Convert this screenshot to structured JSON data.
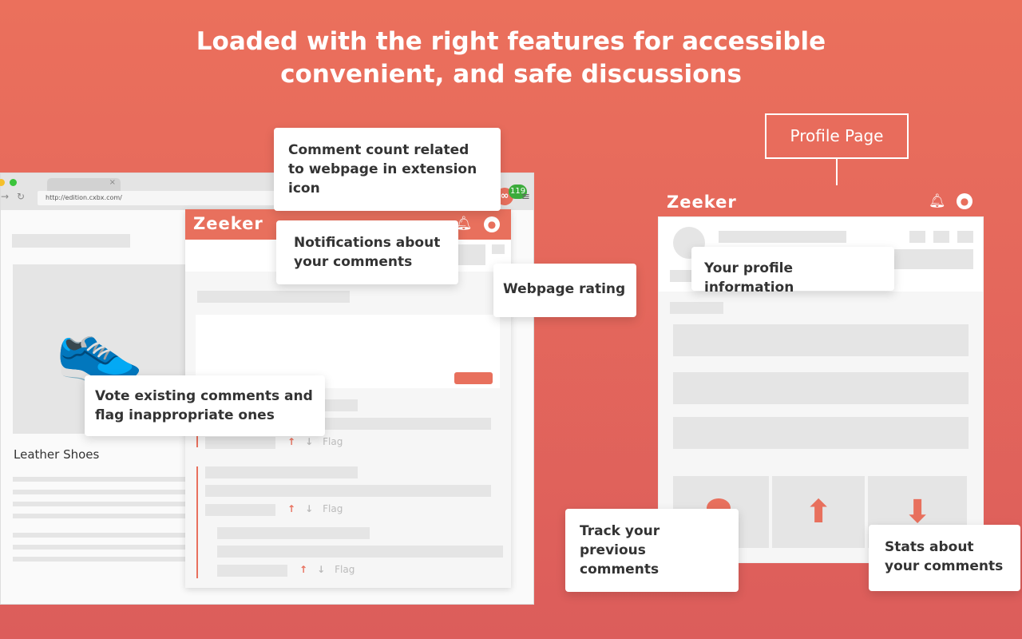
{
  "headline": {
    "line1": "Loaded with the right features for accessible",
    "line2": "convenient, and safe discussions"
  },
  "browser": {
    "url": "http://edition.cxbx.com/",
    "tab_close": "×",
    "badge_count": "119",
    "product_title": "Leather Shoes"
  },
  "extension": {
    "brand": "Zeeker",
    "flag_label": "Flag"
  },
  "profile": {
    "label": "Profile Page",
    "brand": "Zeeker"
  },
  "callouts": {
    "comment_count": "Comment count related to webpage in extension icon",
    "notifications": "Notifications about your comments",
    "rating": "Webpage rating",
    "vote": "Vote existing comments and flag inappropriate ones",
    "profile_info": "Your profile information",
    "track": "Track your previous comments",
    "stats": "Stats about your comments"
  },
  "colors": {
    "accent": "#e8705d",
    "badge": "#3bab3b"
  }
}
